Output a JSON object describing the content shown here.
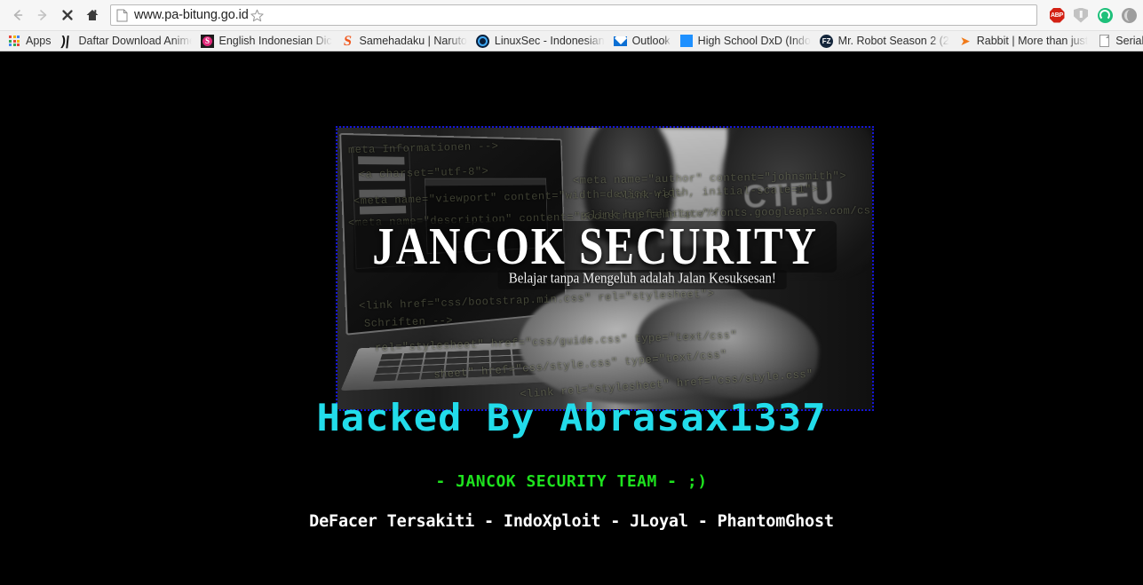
{
  "browser": {
    "nav": {
      "back_icon": "back-arrow-icon",
      "forward_icon": "forward-arrow-icon",
      "stop_icon": "stop-x-icon",
      "home_icon": "home-icon"
    },
    "address_bar": {
      "url": "www.pa-bitung.go.id",
      "page_icon": "page-document-icon",
      "bookmark_star_icon": "star-icon"
    },
    "extensions": [
      {
        "name": "adblock-plus",
        "label": "ABP"
      },
      {
        "name": "shield-extension",
        "label": ""
      },
      {
        "name": "green-circle-extension",
        "label": ""
      },
      {
        "name": "gray-extension",
        "label": ""
      }
    ],
    "bookmarks": [
      {
        "label": "Apps",
        "icon": "apps-grid-icon"
      },
      {
        "label": "Daftar Download Anime",
        "icon": "n-letter-icon"
      },
      {
        "label": "English Indonesian Dictionary",
        "icon": "dictionary-icon"
      },
      {
        "label": "Samehadaku | Naruto",
        "icon": "samehadaku-icon"
      },
      {
        "label": "LinuxSec - Indonesian",
        "icon": "linuxsec-ring-icon"
      },
      {
        "label": "Outlook",
        "icon": "envelope-icon"
      },
      {
        "label": "High School DxD (Indo",
        "icon": "blue-square-icon"
      },
      {
        "label": "Mr. Robot Season 2 (2",
        "icon": "fz-circle-icon"
      },
      {
        "label": "Rabbit | More than just",
        "icon": "rabbit-icon"
      },
      {
        "label": "Serial Dart",
        "icon": "page-document-icon"
      }
    ]
  },
  "page": {
    "background_color": "#000000",
    "banner": {
      "border_color": "#1414d8",
      "title": "JANCOK SECURITY",
      "subtitle": "Belajar tanpa Mengeluh adalah Jalan Kesuksesan!",
      "code_lines": [
        "meta Informationen -->",
        "<a charset=\"utf-8\">",
        "<meta name=\"viewport\" content=\"width=device-width, initial-scale=1\">",
        "<meta name=\"description\" content=\"Bootstrap template\">",
        "<meta name=\"author\" content=\"johnsmith\">",
        "<link rel=",
        "<link href=\"http://fonts.googleapis.com/css?family=Roboto\">",
        "<link href=\"css/bootstrap.min.css\" rel=\"stylesheet\">",
        "Schriften -->",
        "rel=\"stylesheet\" href=\"css/guide.css\" type=\"text/css\"",
        "sheet\" href=\"css/style.css\" type=\"text/css\"",
        "<link rel=\"stylesheet\" href=\"css/style.css\""
      ],
      "photo_watermark": "CTFU"
    },
    "headline": {
      "text": "Hacked By Abrasax1337",
      "color": "#22dcea"
    },
    "team": {
      "text": "- JANCOK SECURITY TEAM - ;)",
      "color": "#1ee21e"
    },
    "credits": {
      "text": "DeFacer Tersakiti - IndoXploit - JLoyal - PhantomGhost",
      "color": "#ffffff"
    }
  }
}
